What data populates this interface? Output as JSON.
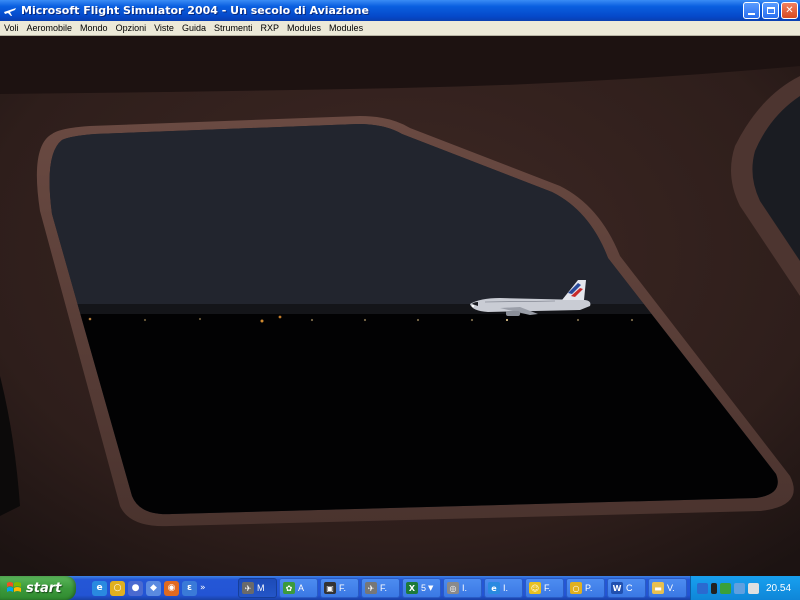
{
  "window": {
    "title": "Microsoft Flight Simulator 2004 - Un secolo di Aviazione",
    "minimize_label": "_",
    "maximize_label": "□",
    "close_label": "✕"
  },
  "menubar": {
    "items": [
      "Voli",
      "Aeromobile",
      "Mondo",
      "Opzioni",
      "Viste",
      "Guida",
      "Strumenti",
      "RXP",
      "Modules",
      "Modules"
    ]
  },
  "viewport": {
    "scene": "cockpit-side-window-night-airport",
    "sky_color": "#20232b",
    "ground_color": "#020203",
    "frame_color": "#3a2622",
    "aircraft_livery": "air-france-tail"
  },
  "taskbar": {
    "start_label": "start",
    "quick_launch_more": "»",
    "tasks": [
      {
        "icon": "flight-sim-icon",
        "label": "M",
        "active": true,
        "color": "#6a6a6a"
      },
      {
        "icon": "app-icon",
        "label": "A",
        "active": false,
        "color": "#3c9a3c"
      },
      {
        "icon": "window-icon",
        "label": "F.",
        "active": false,
        "color": "#333333"
      },
      {
        "icon": "plane-icon",
        "label": "F.",
        "active": false,
        "color": "#777777"
      },
      {
        "icon": "excel-icon",
        "label": "5",
        "active": false,
        "color": "#1d7a3a",
        "has_arrow": true
      },
      {
        "icon": "globe-icon",
        "label": "I.",
        "active": false,
        "color": "#8a8a8a"
      },
      {
        "icon": "ie-icon",
        "label": "I.",
        "active": false,
        "color": "#2a8ae0"
      },
      {
        "icon": "smiley-icon",
        "label": "F.",
        "active": false,
        "color": "#e8c020"
      },
      {
        "icon": "settings-icon",
        "label": "P.",
        "active": false,
        "color": "#e0b020"
      },
      {
        "icon": "word-icon",
        "label": "C",
        "active": false,
        "color": "#2050b0"
      },
      {
        "icon": "folder-icon",
        "label": "V.",
        "active": false,
        "color": "#e8c050"
      }
    ],
    "clock": "20.54"
  }
}
